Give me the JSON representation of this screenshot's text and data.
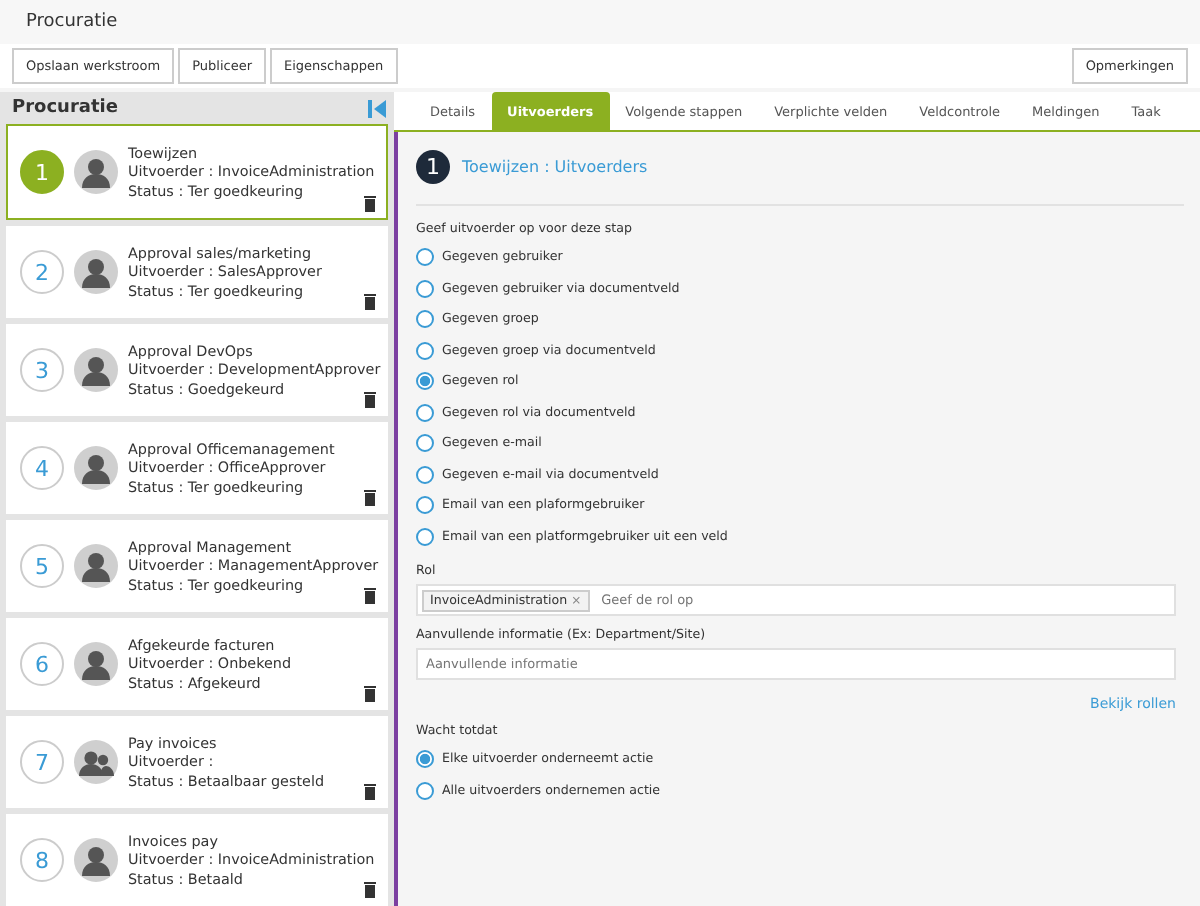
{
  "window": {
    "title": "Procuratie"
  },
  "toolbar": {
    "buttons": [
      "Opslaan werkstroom",
      "Publiceer",
      "Eigenschappen"
    ],
    "right_button": "Opmerkingen"
  },
  "sidebar": {
    "title": "Procuratie",
    "steps": [
      {
        "number": "1",
        "title": "Toewijzen",
        "performer": "Uitvoerder : InvoiceAdministration",
        "status": "Status : Ter goedkeuring",
        "kind": "user",
        "selected": true
      },
      {
        "number": "2",
        "title": "Approval sales/marketing",
        "performer": "Uitvoerder : SalesApprover",
        "status": "Status : Ter goedkeuring",
        "kind": "user",
        "selected": false
      },
      {
        "number": "3",
        "title": "Approval DevOps",
        "performer": "Uitvoerder : DevelopmentApprover",
        "status": "Status : Goedgekeurd",
        "kind": "user",
        "selected": false
      },
      {
        "number": "4",
        "title": "Approval Officemanagement",
        "performer": "Uitvoerder : OfficeApprover",
        "status": "Status : Ter goedkeuring",
        "kind": "user",
        "selected": false
      },
      {
        "number": "5",
        "title": "Approval Management",
        "performer": "Uitvoerder : ManagementApprover",
        "status": "Status : Ter goedkeuring",
        "kind": "user",
        "selected": false
      },
      {
        "number": "6",
        "title": "Afgekeurde facturen",
        "performer": "Uitvoerder : Onbekend",
        "status": "Status : Afgekeurd",
        "kind": "user",
        "selected": false
      },
      {
        "number": "7",
        "title": "Pay invoices",
        "performer": "Uitvoerder :",
        "status": "Status : Betaalbaar gesteld",
        "kind": "group",
        "selected": false
      },
      {
        "number": "8",
        "title": "Invoices pay",
        "performer": "Uitvoerder : InvoiceAdministration",
        "status": "Status : Betaald",
        "kind": "user",
        "selected": false
      }
    ]
  },
  "tabs": [
    {
      "label": "Details",
      "selected": false
    },
    {
      "label": "Uitvoerders",
      "selected": true
    },
    {
      "label": "Volgende stappen",
      "selected": false
    },
    {
      "label": "Verplichte velden",
      "selected": false
    },
    {
      "label": "Veldcontrole",
      "selected": false
    },
    {
      "label": "Meldingen",
      "selected": false
    },
    {
      "label": "Taak",
      "selected": false
    }
  ],
  "panel": {
    "number": "1",
    "heading": "Toewijzen : Uitvoerders",
    "question": "Geef uitvoerder op voor deze stap",
    "options": [
      {
        "label": "Gegeven gebruiker",
        "selected": false
      },
      {
        "label": "Gegeven gebruiker via documentveld",
        "selected": false
      },
      {
        "label": "Gegeven groep",
        "selected": false
      },
      {
        "label": "Gegeven groep via documentveld",
        "selected": false
      },
      {
        "label": "Gegeven rol",
        "selected": true
      },
      {
        "label": "Gegeven rol via documentveld",
        "selected": false
      },
      {
        "label": "Gegeven e-mail",
        "selected": false
      },
      {
        "label": "Gegeven e-mail via documentveld",
        "selected": false
      },
      {
        "label": "Email van een plaformgebruiker",
        "selected": false
      },
      {
        "label": "Email van een platformgebruiker uit een veld",
        "selected": false
      }
    ],
    "role_label": "Rol",
    "role_tag": "InvoiceAdministration",
    "role_tag_remove": "×",
    "role_placeholder": "Geef de rol op",
    "info_label": "Aanvullende informatie (Ex: Department/Site)",
    "info_placeholder": "Aanvullende informatie",
    "link": "Bekijk rollen",
    "wait_label": "Wacht totdat",
    "wait_options": [
      {
        "label": "Elke uitvoerder onderneemt actie",
        "selected": true
      },
      {
        "label": "Alle uitvoerders ondernemen actie",
        "selected": false
      }
    ]
  }
}
